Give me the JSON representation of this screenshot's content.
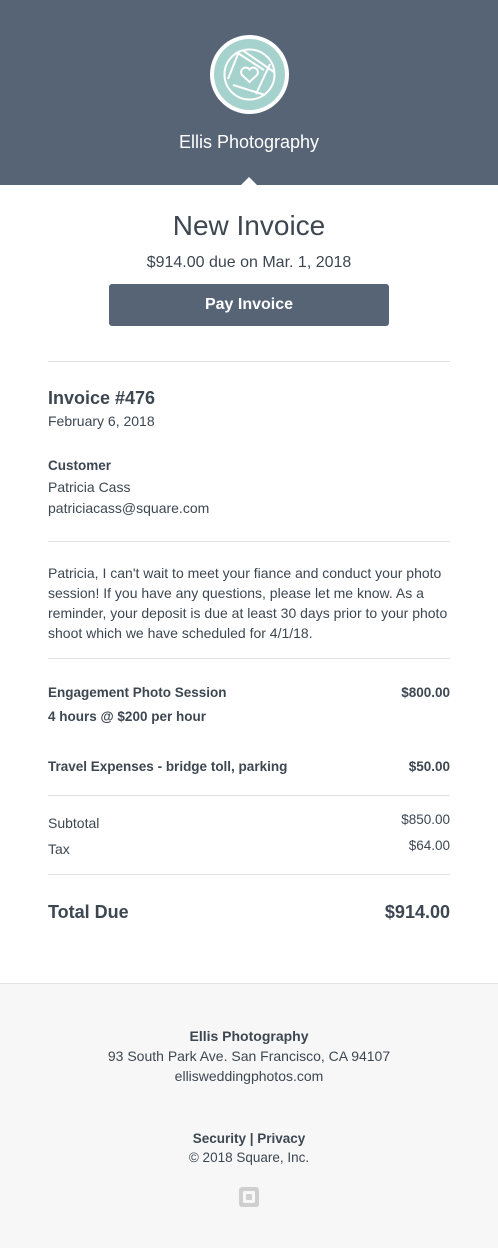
{
  "header": {
    "business_name": "Ellis Photography",
    "logo_icon": "camera-aperture-heart-icon",
    "background_color": "#566476",
    "logo_color": "#a6d2cd"
  },
  "invoice": {
    "title": "New Invoice",
    "due_line": "$914.00 due on Mar. 1, 2018",
    "pay_button_label": "Pay Invoice",
    "number": "Invoice #476",
    "date": "February 6, 2018",
    "customer_label": "Customer",
    "customer_name": "Patricia Cass",
    "customer_email": "patriciacass@square.com",
    "message": "Patricia, I can't wait to meet your fiance and conduct your photo session! If you have any questions, please let me know. As a reminder, your deposit is due at least 30 days prior to your photo shoot which we have scheduled for 4/1/18."
  },
  "line_items": [
    {
      "name": "Engagement Photo Session",
      "detail": "4 hours @ $200 per hour",
      "amount": "$800.00"
    },
    {
      "name": "Travel Expenses - bridge toll, parking",
      "amount": "$50.00"
    }
  ],
  "summary": {
    "subtotal_label": "Subtotal",
    "subtotal_value": "$850.00",
    "tax_label": "Tax",
    "tax_value": "$64.00",
    "total_label": "Total Due",
    "total_value": "$914.00"
  },
  "footer": {
    "business_name": "Ellis Photography",
    "address": "93 South Park Ave. San Francisco, CA 94107",
    "website": "elliswedding​photos.com",
    "security_label": "Security",
    "separator": " | ",
    "privacy_label": "Privacy",
    "copyright": "© 2018 Square, Inc.",
    "square_icon": "square-logo-icon"
  }
}
